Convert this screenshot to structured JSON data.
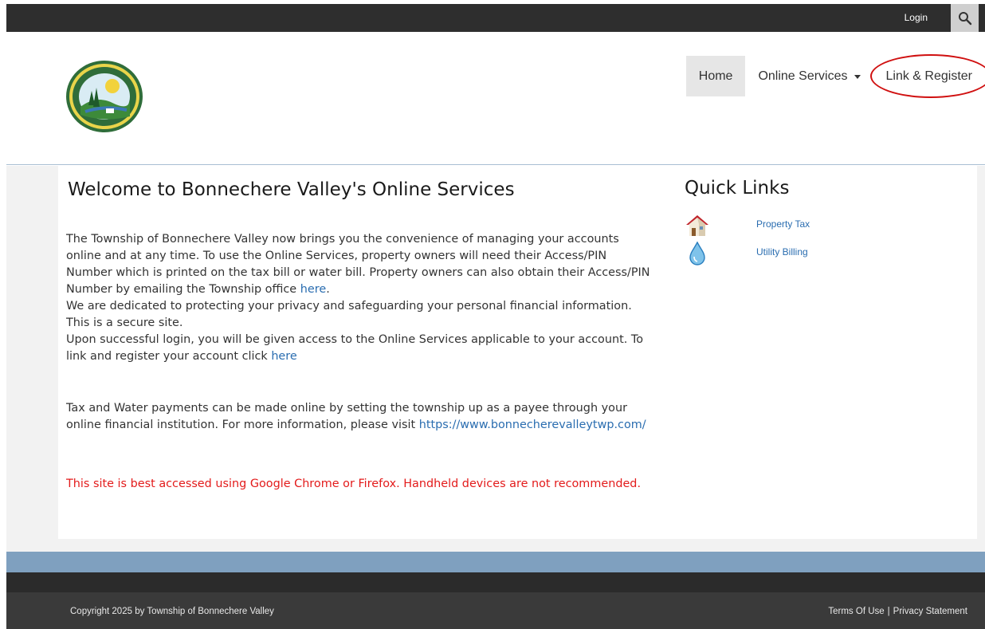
{
  "topbar": {
    "login_label": "Login",
    "search_icon": "search-icon"
  },
  "header": {
    "logo_icon": "township-seal-logo",
    "nav": [
      {
        "label": "Home",
        "active": true
      },
      {
        "label": "Online Services",
        "has_dropdown": true
      },
      {
        "label": "Link & Register",
        "highlighted": true
      }
    ]
  },
  "main": {
    "title": "Welcome to Bonnechere Valley's Online Services",
    "para1": {
      "line_a": "The Township of Bonnechere Valley now brings you the convenience of managing your accounts online and at any time. To use the Online Services, property owners will need their Access/PIN Number which is printed on the tax bill or water bill. Property owners can also obtain their Access/PIN Number by emailing the Township office ",
      "link_a": "here",
      "line_a_end": ".",
      "line_b": "We are dedicated to protecting your privacy and safeguarding your personal financial information. This is a secure site.",
      "line_c": "Upon successful login, you will be given access to the Online Services applicable to your account. To link and register your account click ",
      "link_c": "here"
    },
    "para2": {
      "text": "Tax and Water payments can be made online by setting the township up as a payee through your online financial institution.  For more information, please visit ",
      "link": "https://www.bonnecherevalleytwp.com/"
    },
    "warning": "This site is best accessed using Google Chrome or Firefox. Handheld devices are not recommended."
  },
  "quick_links": {
    "title": "Quick Links",
    "items": [
      {
        "label": "Property Tax",
        "icon": "house-icon"
      },
      {
        "label": "Utility Billing",
        "icon": "water-drop-icon"
      }
    ]
  },
  "footer": {
    "copyright": "Copyright 2025 by Township of Bonnechere Valley",
    "terms": "Terms Of Use",
    "separator": "|",
    "privacy": "Privacy Statement"
  },
  "colors": {
    "topbar": "#2e2e2e",
    "link": "#2a6db0",
    "warning": "#e31b1b",
    "band": "#7fa0bf",
    "highlight_ellipse": "#d01010"
  }
}
